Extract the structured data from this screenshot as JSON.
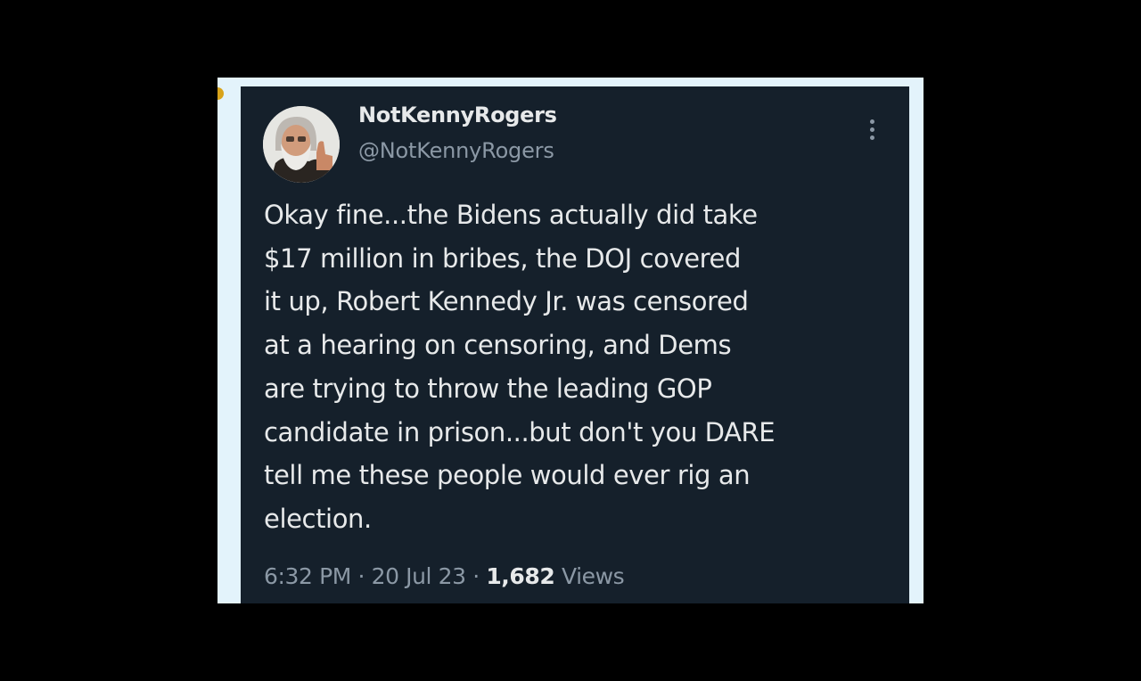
{
  "tweet": {
    "display_name": "NotKennyRogers",
    "handle": "@NotKennyRogers",
    "text_lines": [
      "Okay fine...the Bidens actually did take",
      "$17 million in bribes, the DOJ covered",
      "it up, Robert Kennedy Jr. was censored",
      "at a hearing on censoring, and Dems",
      "are trying to throw the leading GOP",
      "candidate in prison...but don't you DARE",
      "tell me these people would ever rig an",
      "election."
    ],
    "time": "6:32 PM",
    "separator": "·",
    "date": "20 Jul 23",
    "views_count": "1,682",
    "views_label": "Views"
  },
  "icons": {
    "avatar": "avatar-photo",
    "more": "more-vertical-icon"
  },
  "colors": {
    "page_background": "#000000",
    "frame": "#e3f3fb",
    "tweet_background": "#15202b",
    "primary_text": "#e7e9ea",
    "secondary_text": "#8b98a5"
  }
}
